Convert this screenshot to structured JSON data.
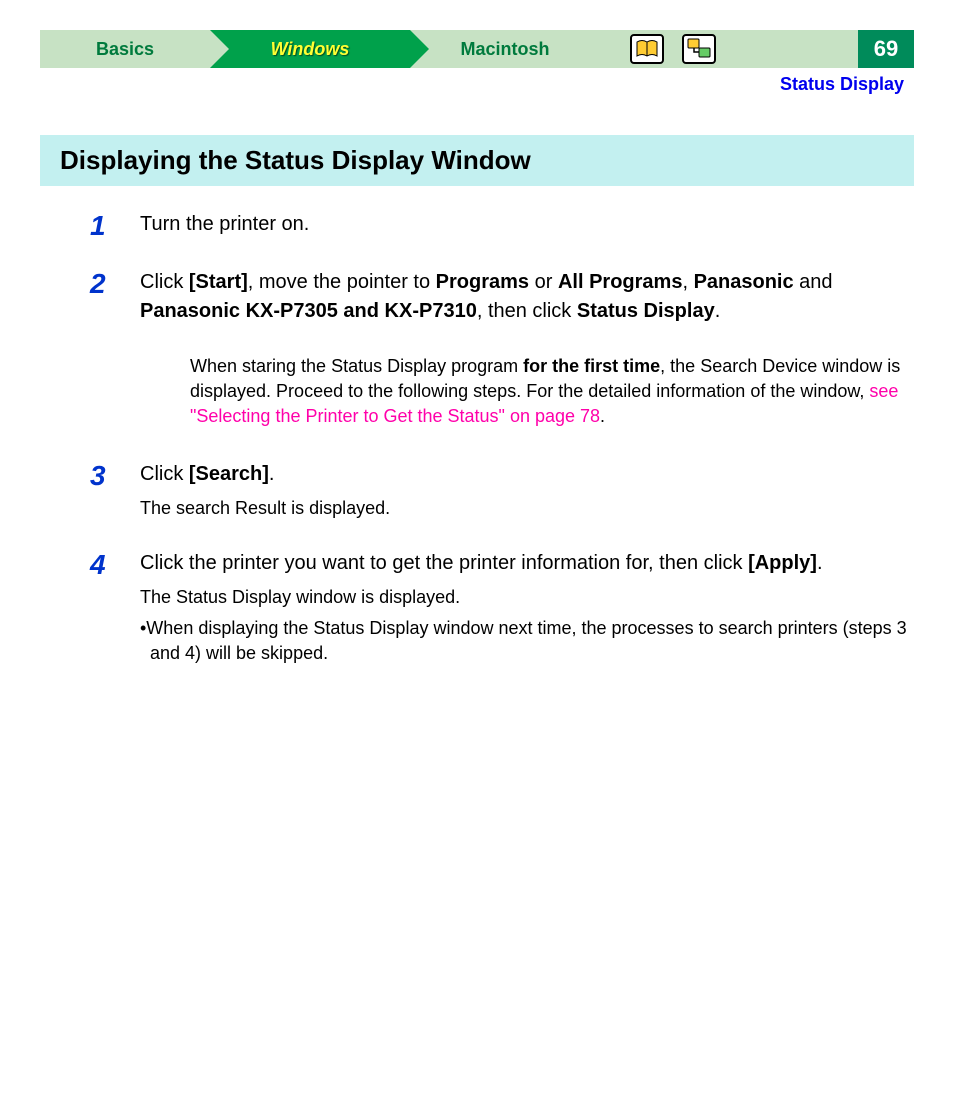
{
  "header": {
    "tab_basics": "Basics",
    "tab_windows": "Windows",
    "tab_mac": "Macintosh",
    "page_number": "69"
  },
  "section_label": "Status Display",
  "title": "Displaying the Status Display Window",
  "steps": {
    "s1": {
      "num": "1",
      "text": "Turn the printer on."
    },
    "s2": {
      "num": "2",
      "t1": "Click ",
      "b1": "[Start]",
      "t2": ", move the pointer to ",
      "b2": "Programs",
      "t3": " or ",
      "b3": "All Programs",
      "t4": ", ",
      "b4": "Panasonic",
      "t5": " and ",
      "b5": "Panasonic KX-P7305 and KX-P7310",
      "t6": ", then click ",
      "b6": "Status Display",
      "t7": "."
    },
    "note2": {
      "t1": "When staring the Status Display program ",
      "b1": "for the first time",
      "t2": ", the Search Device window is displayed. Proceed to the following steps. For the detailed information of the window, ",
      "link": "see \"Selecting the Printer to Get the Status\" on page 78",
      "t3": "."
    },
    "s3": {
      "num": "3",
      "t1": "Click ",
      "b1": "[Search]",
      "t2": ".",
      "sub": "The search Result is displayed."
    },
    "s4": {
      "num": "4",
      "t1": "Click the printer you want to get the printer information for, then click ",
      "b1": "[Apply]",
      "t2": ".",
      "sub1": "The Status Display window is displayed.",
      "bullet": "•When displaying the Status Display window next time, the processes to search printers (steps 3 and 4) will be skipped."
    }
  }
}
